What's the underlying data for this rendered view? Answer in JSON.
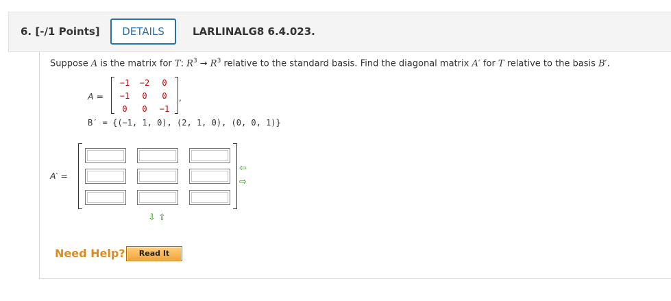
{
  "question": {
    "number_points": "6.  [-/1 Points]",
    "details_label": "DETAILS",
    "code": "LARLINALG8 6.4.023.",
    "prompt": {
      "p1": "Suppose ",
      "v_A": "A",
      "p2": " is the matrix for ",
      "v_T": "T",
      "p3": ": ",
      "v_R1": "R",
      "exp1": "3",
      "p4": " → ",
      "v_R2": "R",
      "exp2": "3",
      "p5": "  relative to the standard basis. Find the diagonal matrix ",
      "v_Ap": "A′",
      "p6": " for ",
      "v_T2": "T",
      "p7": " relative to the basis ",
      "v_Bp": "B′",
      "p8": "."
    }
  },
  "matrix_A": {
    "label_var": "A",
    "label_eq": " =",
    "rows": [
      [
        "−1",
        "−2",
        "0"
      ],
      [
        "−1",
        "0",
        "0"
      ],
      [
        "0",
        "0",
        "−1"
      ]
    ],
    "trailing": ","
  },
  "basis": {
    "text": "B′ = {(−1, 1, 0), (2, 1, 0), (0, 0, 1)}"
  },
  "answer": {
    "label_var": "A′",
    "label_eq": " =",
    "rows": [
      [
        "",
        "",
        ""
      ],
      [
        "",
        "",
        ""
      ],
      [
        "",
        "",
        ""
      ]
    ]
  },
  "controls": {
    "add_col_icon": "⇦",
    "remove_col_icon": "⇨",
    "add_row_icon": "⇩",
    "remove_row_icon": "⇧"
  },
  "help": {
    "need_help": "Need Help?",
    "read_it": "Read It"
  }
}
